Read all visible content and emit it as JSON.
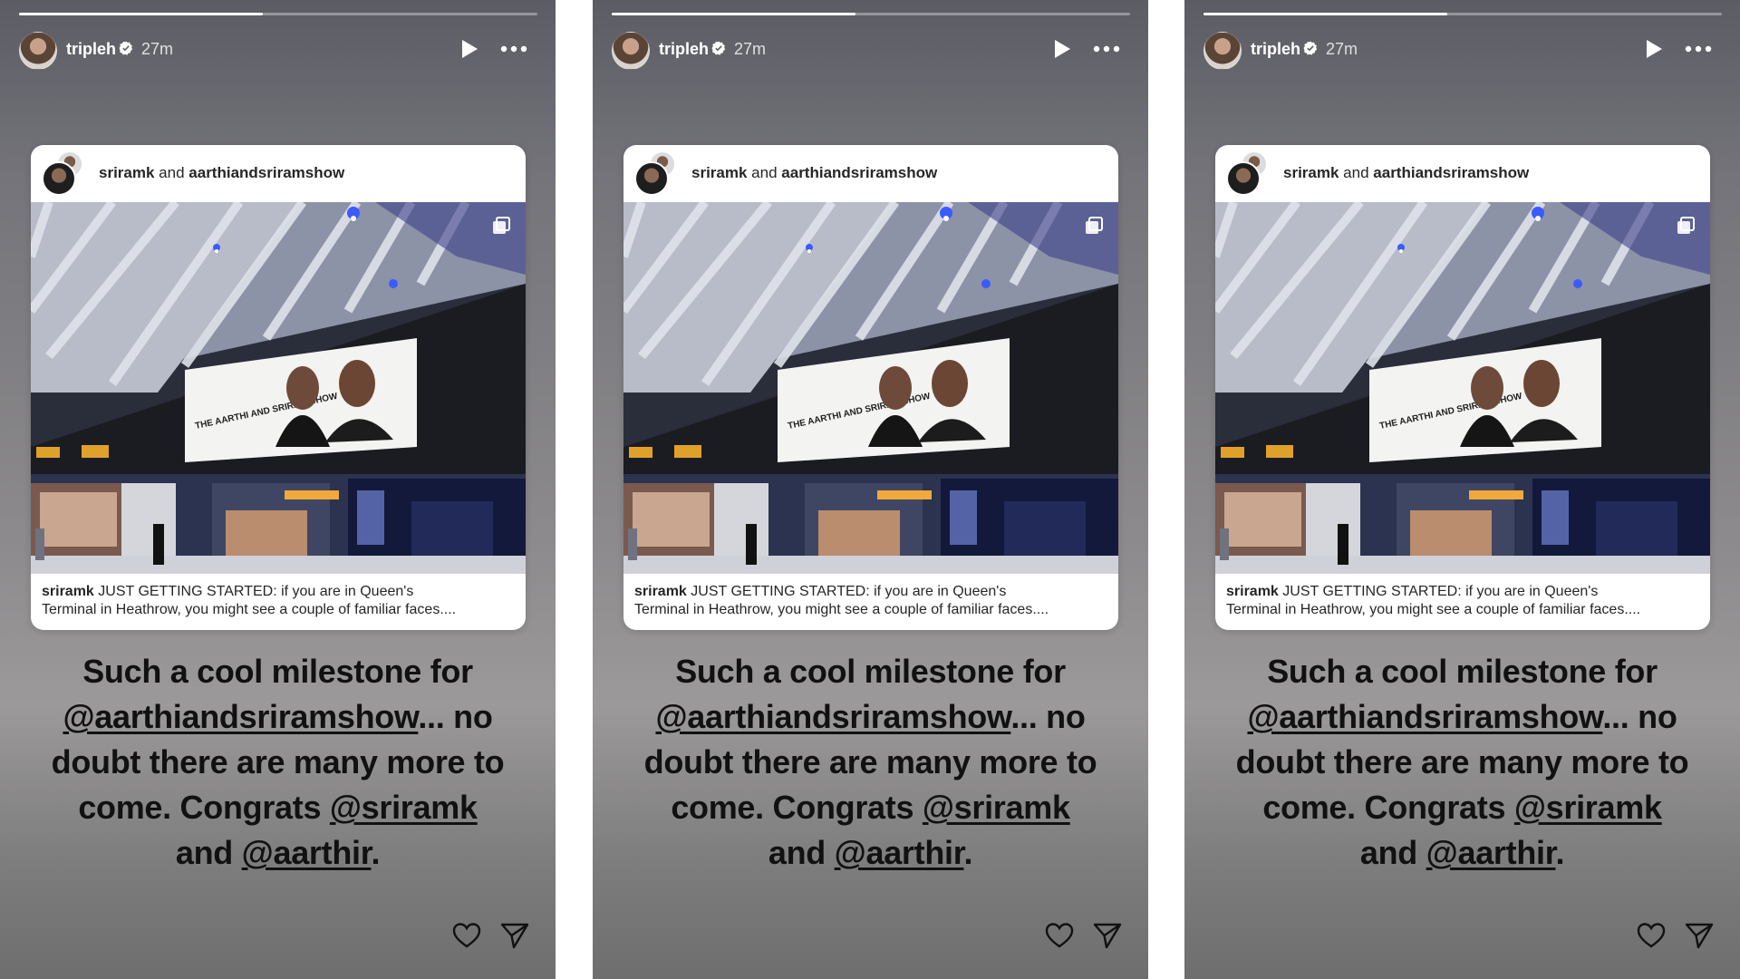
{
  "stories": [
    {
      "progress": 0.47,
      "header": {
        "username": "tripleh",
        "time": "27m"
      },
      "shared_post": {
        "author": "sriramk",
        "joiner": "and",
        "coauthor": "aarthiandsriramshow",
        "caption_user": "sriramk",
        "caption_line1": "JUST GETTING STARTED: if you are in Queen's",
        "caption_line2": "Terminal in Heathrow, you might see a couple of familiar faces...."
      },
      "text": {
        "line1": "Such a cool milestone for",
        "mention1": "@aarthiandsriramshow",
        "after_mention1": "... no",
        "line3": "doubt there are many more to",
        "line4_pre": "come. Congrats ",
        "mention2": "@sriramk",
        "line5_pre": "and ",
        "mention3": "@aarthir",
        "line5_post": "."
      }
    },
    {
      "progress": 0.47,
      "header": {
        "username": "tripleh",
        "time": "27m"
      },
      "shared_post": {
        "author": "sriramk",
        "joiner": "and",
        "coauthor": "aarthiandsriramshow",
        "caption_user": "sriramk",
        "caption_line1": "JUST GETTING STARTED: if you are in Queen's",
        "caption_line2": "Terminal in Heathrow, you might see a couple of familiar faces...."
      },
      "text": {
        "line1": "Such a cool milestone for",
        "mention1": "@aarthiandsriramshow",
        "after_mention1": "... no",
        "line3": "doubt there are many more to",
        "line4_pre": "come. Congrats ",
        "mention2": "@sriramk",
        "line5_pre": "and ",
        "mention3": "@aarthir",
        "line5_post": "."
      }
    },
    {
      "progress": 0.47,
      "header": {
        "username": "tripleh",
        "time": "27m"
      },
      "shared_post": {
        "author": "sriramk",
        "joiner": "and",
        "coauthor": "aarthiandsriramshow",
        "caption_user": "sriramk",
        "caption_line1": "JUST GETTING STARTED: if you are in Queen's",
        "caption_line2": "Terminal in Heathrow, you might see a couple of familiar faces...."
      },
      "text": {
        "line1": "Such a cool milestone for",
        "mention1": "@aarthiandsriramshow",
        "after_mention1": "... no",
        "line3": "doubt there are many more to",
        "line4_pre": "come. Congrats ",
        "mention2": "@sriramk",
        "line5_pre": "and ",
        "mention3": "@aarthir",
        "line5_post": "."
      }
    }
  ],
  "billboard": {
    "title": "THE AARTHI AND SRIRAM SHOW"
  },
  "icons": {
    "verified": "verified-badge-icon",
    "play": "play-icon",
    "more": "more-options-icon",
    "like": "heart-icon",
    "share": "send-icon",
    "multi": "carousel-icon"
  },
  "colors": {
    "verified": "#ffffff",
    "text": "#111111"
  }
}
